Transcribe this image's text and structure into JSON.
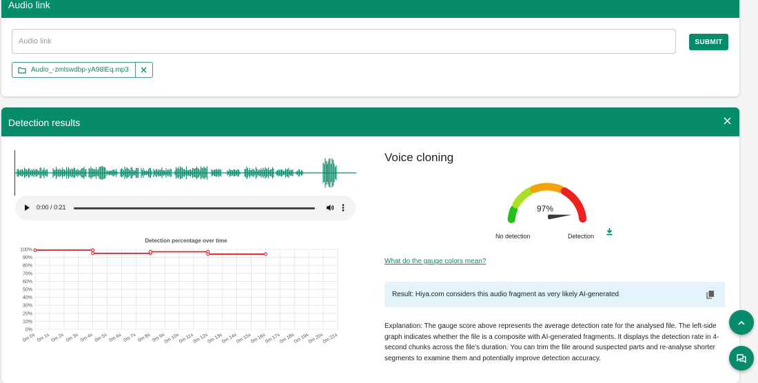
{
  "audio_card": {
    "title": "Audio link",
    "input_placeholder": "Audio link",
    "input_value": "",
    "submit_label": "SUBMIT",
    "file_name": "Audio_-zmlswdbp-yA98lEq.mp3"
  },
  "results_card": {
    "title": "Detection results",
    "player": {
      "time": "0:00 / 0:21",
      "progress": 0
    },
    "voice_cloning": {
      "title": "Voice cloning",
      "percentage": "97%",
      "percentage_value": 97,
      "label_left": "No detection",
      "label_right": "Detection"
    },
    "gauge_link": "What do the gauge colors mean?",
    "result_text": "Result: Hiya.com considers this audio fragment as very likely AI-generated",
    "explanation": "Explanation: The gauge score above represents the average detection rate for the analysed file. The left-side graph indicates whether the file is a composite with AI-generated fragments. It displays the detection rate in 4-second chunks across the file's duration. You can trim the file around suspected parts and re-analyse shorter segments to examine them and potentially improve detection accuracy."
  },
  "colors": {
    "accent": "#068c6a",
    "series": "#e02020"
  },
  "chart_data": {
    "type": "line",
    "title": "Detection percentage over time",
    "xlabel": "",
    "ylabel": "",
    "x_ticks": [
      "0m 0s",
      "0m 1s",
      "0m 2s",
      "0m 3s",
      "0m 4s",
      "0m 5s",
      "0m 6s",
      "0m 7s",
      "0m 8s",
      "0m 9s",
      "0m 10s",
      "0m 11s",
      "0m 12s",
      "0m 13s",
      "0m 14s",
      "0m 15s",
      "0m 16s",
      "0m 17s",
      "0m 18s",
      "0m 19s",
      "0m 20s",
      "0m 21s"
    ],
    "y_ticks": [
      "0%",
      "10%",
      "20%",
      "30%",
      "40%",
      "50%",
      "60%",
      "70%",
      "80%",
      "90%",
      "100%"
    ],
    "ylim": [
      0,
      100
    ],
    "xlim": [
      0,
      21
    ],
    "grid": true,
    "series": [
      {
        "x": [
          0,
          4,
          4,
          8,
          8,
          12,
          12,
          16
        ],
        "y": [
          99,
          99,
          95,
          95,
          97,
          97,
          94,
          94
        ]
      }
    ],
    "markers": [
      {
        "x": 0,
        "y": 99
      },
      {
        "x": 4,
        "y": 99
      },
      {
        "x": 4,
        "y": 95
      },
      {
        "x": 8,
        "y": 95
      },
      {
        "x": 8,
        "y": 97
      },
      {
        "x": 12,
        "y": 97
      },
      {
        "x": 12,
        "y": 94
      },
      {
        "x": 16,
        "y": 94
      }
    ]
  }
}
